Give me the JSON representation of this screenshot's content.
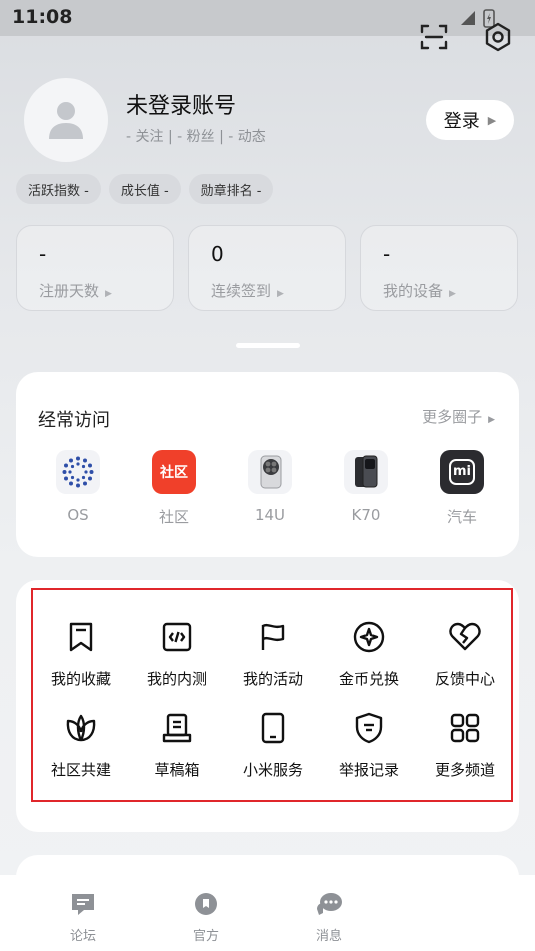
{
  "status_bar": {
    "time": "11:08"
  },
  "top_actions": {
    "scan_icon": "scan-icon",
    "settings_icon": "settings-icon"
  },
  "profile": {
    "name": "未登录账号",
    "sub": "- 关注 | - 粉丝 | - 动态",
    "login_label": "登录"
  },
  "badges": [
    "活跃指数 -",
    "成长值 -",
    "勋章排名 -"
  ],
  "stats": [
    {
      "value": "-",
      "label": "注册天数"
    },
    {
      "value": "0",
      "label": "连续签到"
    },
    {
      "value": "-",
      "label": "我的设备"
    }
  ],
  "frequent": {
    "title": "经常访问",
    "more": "更多圈子",
    "items": [
      {
        "label": "OS",
        "icon": "os-icon"
      },
      {
        "label": "社区",
        "icon": "community-icon",
        "icon_text": "社区"
      },
      {
        "label": "14U",
        "icon": "phone-14u-icon"
      },
      {
        "label": "K70",
        "icon": "phone-k70-icon"
      },
      {
        "label": "汽车",
        "icon": "mi-car-icon",
        "icon_text": "mi"
      }
    ]
  },
  "services": {
    "items": [
      {
        "label": "我的收藏",
        "icon": "bookmark-icon"
      },
      {
        "label": "我的内测",
        "icon": "code-icon"
      },
      {
        "label": "我的活动",
        "icon": "flag-icon"
      },
      {
        "label": "金币兑换",
        "icon": "coin-icon"
      },
      {
        "label": "反馈中心",
        "icon": "heart-icon"
      },
      {
        "label": "社区共建",
        "icon": "leaf-icon"
      },
      {
        "label": "草稿箱",
        "icon": "draft-icon"
      },
      {
        "label": "小米服务",
        "icon": "tablet-icon"
      },
      {
        "label": "举报记录",
        "icon": "shield-icon"
      },
      {
        "label": "更多频道",
        "icon": "grid-icon"
      }
    ]
  },
  "tabbar": [
    {
      "label": "论坛",
      "icon": "forum-icon"
    },
    {
      "label": "官方",
      "icon": "official-icon"
    },
    {
      "label": "消息",
      "icon": "message-icon"
    }
  ],
  "colors": {
    "highlight": "#e0262b",
    "community": "#f0402a",
    "mi_car": "#2b2b2f"
  }
}
